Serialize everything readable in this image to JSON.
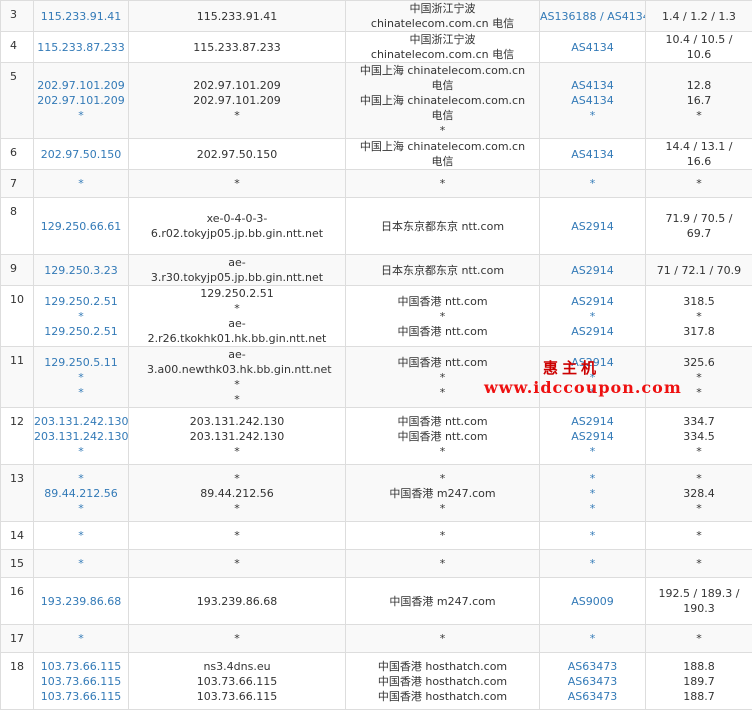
{
  "rows": [
    {
      "hop": "3",
      "ip": [
        "115.233.91.41"
      ],
      "host": [
        "115.233.91.41"
      ],
      "loc": [
        "中国浙江宁波 chinatelecom.com.cn 电信"
      ],
      "asn": [
        "AS136188 / AS4134"
      ],
      "lat": [
        "1.4 / 1.2 / 1.3"
      ]
    },
    {
      "hop": "4",
      "ip": [
        "115.233.87.233"
      ],
      "host": [
        "115.233.87.233"
      ],
      "loc": [
        "中国浙江宁波 chinatelecom.com.cn 电信"
      ],
      "asn": [
        "AS4134"
      ],
      "lat": [
        "10.4 / 10.5 / 10.6"
      ]
    },
    {
      "hop": "5",
      "ip": [
        "202.97.101.209",
        "202.97.101.209",
        "*"
      ],
      "host": [
        "202.97.101.209",
        "202.97.101.209",
        "*"
      ],
      "loc": [
        "中国上海 chinatelecom.com.cn 电信",
        "中国上海 chinatelecom.com.cn 电信",
        "*"
      ],
      "asn": [
        "AS4134",
        "AS4134",
        "*"
      ],
      "lat": [
        "12.8",
        "16.7",
        "*"
      ]
    },
    {
      "hop": "6",
      "ip": [
        "202.97.50.150"
      ],
      "host": [
        "202.97.50.150"
      ],
      "loc": [
        "中国上海 chinatelecom.com.cn 电信"
      ],
      "asn": [
        "AS4134"
      ],
      "lat": [
        "14.4 / 13.1 / 16.6"
      ]
    },
    {
      "hop": "7",
      "ip": [
        "*"
      ],
      "host": [
        "*"
      ],
      "loc": [
        "*"
      ],
      "asn": [
        "*"
      ],
      "lat": [
        "*"
      ]
    },
    {
      "hop": "8",
      "ip": [
        "129.250.66.61"
      ],
      "host": [
        "xe-0-4-0-3-6.r02.tokyjp05.jp.bb.gin.ntt.net"
      ],
      "loc": [
        "日本东京都东京 ntt.com"
      ],
      "asn": [
        "AS2914"
      ],
      "lat": [
        "71.9 / 70.5 / 69.7"
      ]
    },
    {
      "hop": "9",
      "ip": [
        "129.250.3.23"
      ],
      "host": [
        "ae-3.r30.tokyjp05.jp.bb.gin.ntt.net"
      ],
      "loc": [
        "日本东京都东京 ntt.com"
      ],
      "asn": [
        "AS2914"
      ],
      "lat": [
        "71 / 72.1 / 70.9"
      ]
    },
    {
      "hop": "10",
      "ip": [
        "129.250.2.51",
        "*",
        "129.250.2.51"
      ],
      "host": [
        "129.250.2.51",
        "*",
        "ae-2.r26.tkokhk01.hk.bb.gin.ntt.net"
      ],
      "loc": [
        "中国香港 ntt.com",
        "*",
        "中国香港 ntt.com"
      ],
      "asn": [
        "AS2914",
        "*",
        "AS2914"
      ],
      "lat": [
        "318.5",
        "*",
        "317.8"
      ]
    },
    {
      "hop": "11",
      "ip": [
        "129.250.5.11",
        "*",
        "*"
      ],
      "host": [
        "ae-3.a00.newthk03.hk.bb.gin.ntt.net",
        "*",
        "*"
      ],
      "loc": [
        "中国香港 ntt.com",
        "*",
        "*"
      ],
      "asn": [
        "AS2914",
        "*",
        "*"
      ],
      "lat": [
        "325.6",
        "*",
        "*"
      ]
    },
    {
      "hop": "12",
      "ip": [
        "203.131.242.130",
        "203.131.242.130",
        "*"
      ],
      "host": [
        "203.131.242.130",
        "203.131.242.130",
        "*"
      ],
      "loc": [
        "中国香港 ntt.com",
        "中国香港 ntt.com",
        "*"
      ],
      "asn": [
        "AS2914",
        "AS2914",
        "*"
      ],
      "lat": [
        "334.7",
        "334.5",
        "*"
      ]
    },
    {
      "hop": "13",
      "ip": [
        "*",
        "89.44.212.56",
        "*"
      ],
      "host": [
        "*",
        "89.44.212.56",
        "*"
      ],
      "loc": [
        "*",
        "中国香港 m247.com",
        "*"
      ],
      "asn": [
        "*",
        "*",
        "*"
      ],
      "lat": [
        "*",
        "328.4",
        "*"
      ]
    },
    {
      "hop": "14",
      "ip": [
        "*"
      ],
      "host": [
        "*"
      ],
      "loc": [
        "*"
      ],
      "asn": [
        "*"
      ],
      "lat": [
        "*"
      ]
    },
    {
      "hop": "15",
      "ip": [
        "*"
      ],
      "host": [
        "*"
      ],
      "loc": [
        "*"
      ],
      "asn": [
        "*"
      ],
      "lat": [
        "*"
      ]
    },
    {
      "hop": "16",
      "ip": [
        "193.239.86.68"
      ],
      "host": [
        "193.239.86.68"
      ],
      "loc": [
        "中国香港 m247.com"
      ],
      "asn": [
        "AS9009"
      ],
      "lat": [
        "192.5 / 189.3 / 190.3"
      ]
    },
    {
      "hop": "17",
      "ip": [
        "*"
      ],
      "host": [
        "*"
      ],
      "loc": [
        "*"
      ],
      "asn": [
        "*"
      ],
      "lat": [
        "*"
      ]
    },
    {
      "hop": "18",
      "ip": [
        "103.73.66.115",
        "103.73.66.115",
        "103.73.66.115"
      ],
      "host": [
        "ns3.4dns.eu",
        "103.73.66.115",
        "103.73.66.115"
      ],
      "loc": [
        "中国香港 hosthatch.com",
        "中国香港 hosthatch.com",
        "中国香港 hosthatch.com"
      ],
      "asn": [
        "AS63473",
        "AS63473",
        "AS63473"
      ],
      "lat": [
        "188.8",
        "189.7",
        "188.7"
      ]
    }
  ],
  "watermark": {
    "brand": "惠主机",
    "url": "www.idccoupon.com"
  },
  "colors": {
    "link": "#337ab7",
    "text": "#333333",
    "border": "#dddddd",
    "row_alt": "#f9f9f9",
    "watermark": "#cc0000"
  }
}
